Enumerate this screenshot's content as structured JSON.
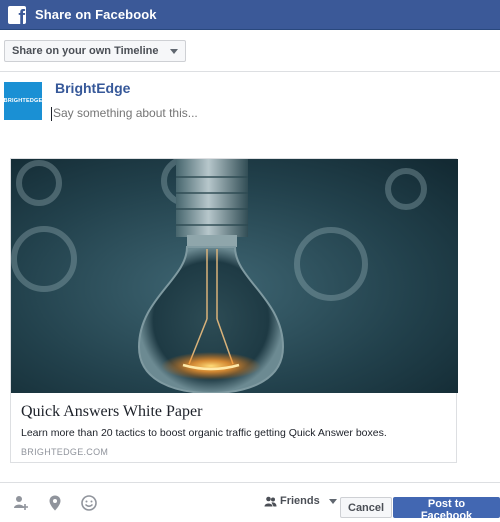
{
  "header": {
    "title": "Share on Facebook",
    "logo_letter": "f",
    "logo_icon": "facebook-icon"
  },
  "toolbar": {
    "share_target": "Share on your own Timeline"
  },
  "composer": {
    "page_name": "BrightEdge",
    "avatar_text": "BRIGHTEDGE",
    "placeholder": "Say something about this..."
  },
  "link_card": {
    "image_subject": "lightbulb-image",
    "title": "Quick Answers White Paper",
    "description": "Learn more than 20 tactics to boost organic traffic getting Quick Answer boxes.",
    "domain": "BRIGHTEDGE.COM"
  },
  "footer": {
    "icons": [
      "tag-friends-icon",
      "location-icon",
      "feeling-icon"
    ],
    "audience": "Friends",
    "cancel_label": "Cancel",
    "post_label": "Post to Facebook"
  },
  "colors": {
    "brand_blue": "#3b5998",
    "button_blue": "#4267b2",
    "link_blue": "#365899"
  }
}
